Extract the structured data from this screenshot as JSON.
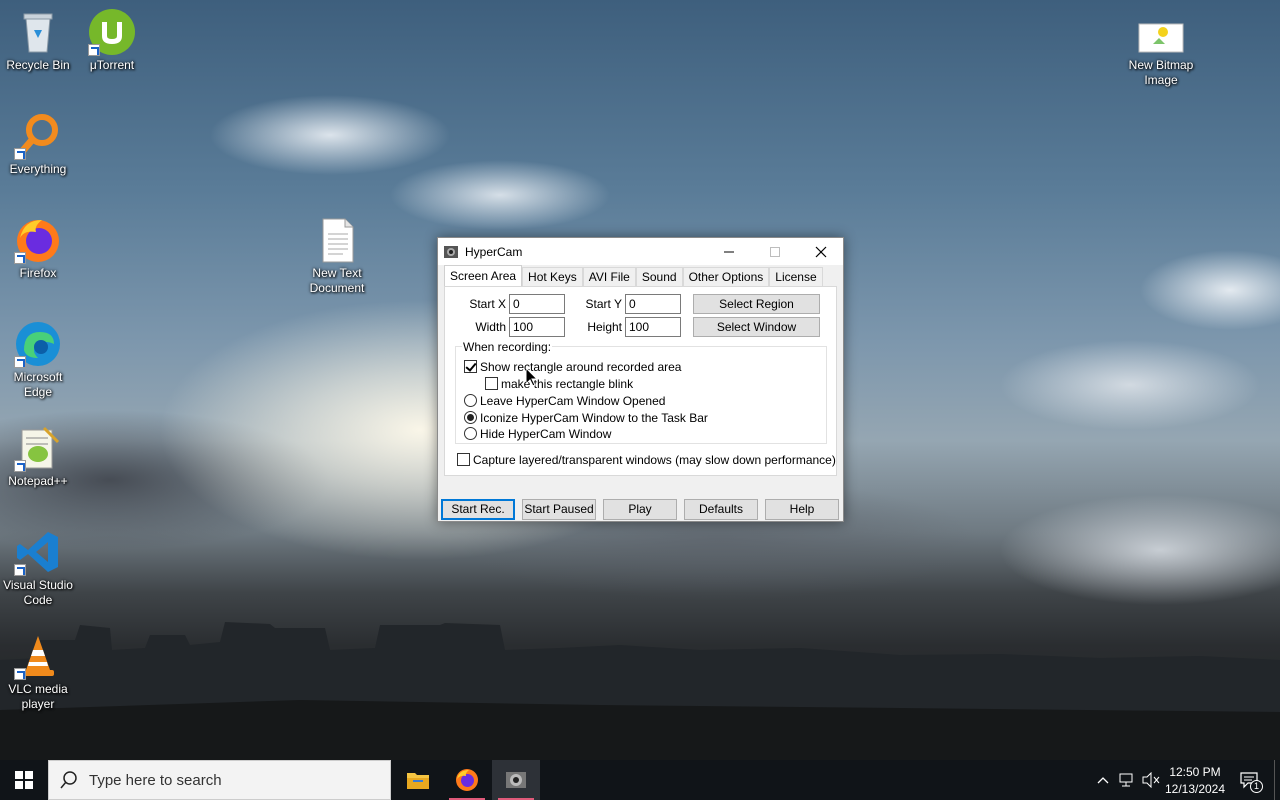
{
  "desktop": {
    "icons": [
      {
        "label": "Recycle Bin"
      },
      {
        "label": "μTorrent"
      },
      {
        "label": "Everything"
      },
      {
        "label": "Firefox"
      },
      {
        "label": "Microsoft Edge"
      },
      {
        "label": "Notepad++"
      },
      {
        "label": "Visual Studio Code"
      },
      {
        "label": "VLC media player"
      },
      {
        "label": "New Text Document"
      },
      {
        "label": "New Bitmap Image"
      }
    ]
  },
  "window": {
    "title": "HyperCam",
    "tabs": [
      {
        "label": "Screen Area",
        "active": true
      },
      {
        "label": "Hot Keys"
      },
      {
        "label": "AVI File"
      },
      {
        "label": "Sound"
      },
      {
        "label": "Other Options"
      },
      {
        "label": "License"
      }
    ],
    "fields": {
      "start_x_label": "Start X",
      "start_x_value": "0",
      "start_y_label": "Start Y",
      "start_y_value": "0",
      "width_label": "Width",
      "width_value": "100",
      "height_label": "Height",
      "height_value": "100"
    },
    "select_region": "Select Region",
    "select_window": "Select Window",
    "when_recording": "When recording:",
    "options": {
      "show_rectangle": {
        "label": "Show rectangle around recorded area",
        "checked": true
      },
      "blink": {
        "label": "make this rectangle blink",
        "checked": false
      },
      "leave_opened": {
        "label": "Leave HyperCam Window Opened",
        "selected": false
      },
      "iconize": {
        "label": "Iconize HyperCam Window to the Task Bar",
        "selected": true
      },
      "hide": {
        "label": "Hide HyperCam Window",
        "selected": false
      },
      "capture_layered": {
        "label": "Capture layered/transparent windows (may slow down performance)",
        "checked": false
      }
    },
    "buttons": {
      "start_rec": "Start Rec.",
      "start_paused": "Start Paused",
      "play": "Play",
      "defaults": "Defaults",
      "help": "Help"
    }
  },
  "taskbar": {
    "search_placeholder": "Type here to search",
    "time": "12:50 PM",
    "date": "12/13/2024",
    "notification_count": "1"
  },
  "colors": {
    "accent": "#0078d7",
    "taskbar": "#101418",
    "running_indicator": "#e05a7a"
  }
}
